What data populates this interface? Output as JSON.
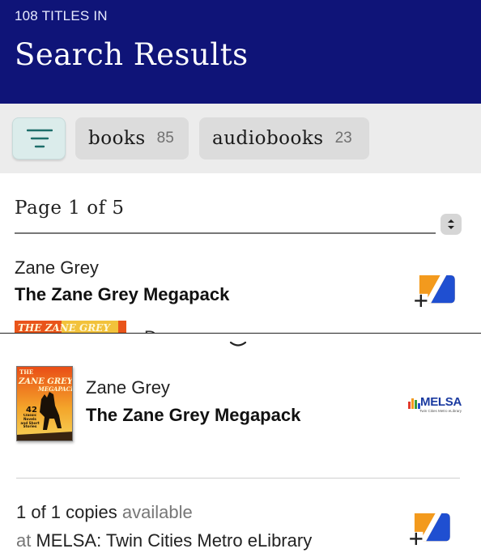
{
  "header": {
    "count_label": "108 TITLES IN",
    "title": "Search Results",
    "background": "#0f1478"
  },
  "filters": {
    "filter_icon": "filter-lines-icon",
    "chips": [
      {
        "label": "books",
        "count": "85"
      },
      {
        "label": "audiobooks",
        "count": "23"
      }
    ]
  },
  "pagination": {
    "label": "Page 1 of 5",
    "sort_icon": "up-down-chevron-icon"
  },
  "result": {
    "author": "Zane Grey",
    "title": "The Zane Grey Megapack",
    "cover_text": "THE ZANE GREY",
    "peek_text": "D",
    "add_icon": "add-to-list-icon"
  },
  "sheet": {
    "handle_icon": "chevron-down-icon",
    "cover": {
      "line1": "THE",
      "line2": "ZANE GREY",
      "line3": "MEGAPACK",
      "number": "42",
      "subtitle": "Classic Novels and Short Stories"
    },
    "author": "Zane Grey",
    "title": "The Zane Grey Megapack",
    "library_logo": {
      "name": "MELSA",
      "tagline": "Twin Cities Metro eLibrary"
    },
    "copies_count": "1 of 1 copies",
    "copies_status": "available",
    "library_prefix": "at",
    "library_name": "MELSA: Twin Cities Metro eLibrary",
    "add_icon": "add-to-list-icon"
  },
  "colors": {
    "accent_orange": "#f39a1d",
    "accent_blue": "#1f4fd1"
  }
}
